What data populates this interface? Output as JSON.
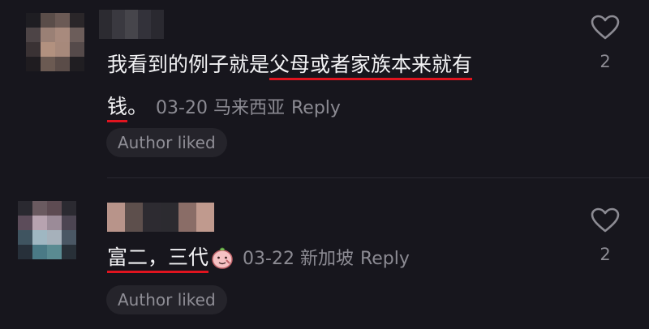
{
  "comments": [
    {
      "text_before": "我看到的例子就是",
      "text_highlight": "父母或者家族本来就有",
      "text_highlight_2": "钱",
      "text_after": "。",
      "date": "03-20",
      "location": "马来西亚",
      "reply_label": "Reply",
      "author_liked_label": "Author liked",
      "like_count": "2"
    },
    {
      "text_highlight": "富二，三代",
      "emoji": "peach-emoji",
      "date": "03-22",
      "location": "新加坡",
      "reply_label": "Reply",
      "author_liked_label": "Author liked",
      "like_count": "2"
    }
  ],
  "icons": {
    "like": "heart-icon",
    "emoji": "peach-emoji"
  },
  "colors": {
    "background": "#17161d",
    "underline": "#e0141f",
    "muted_text": "#8c8b93",
    "chip_bg": "#25242b"
  }
}
